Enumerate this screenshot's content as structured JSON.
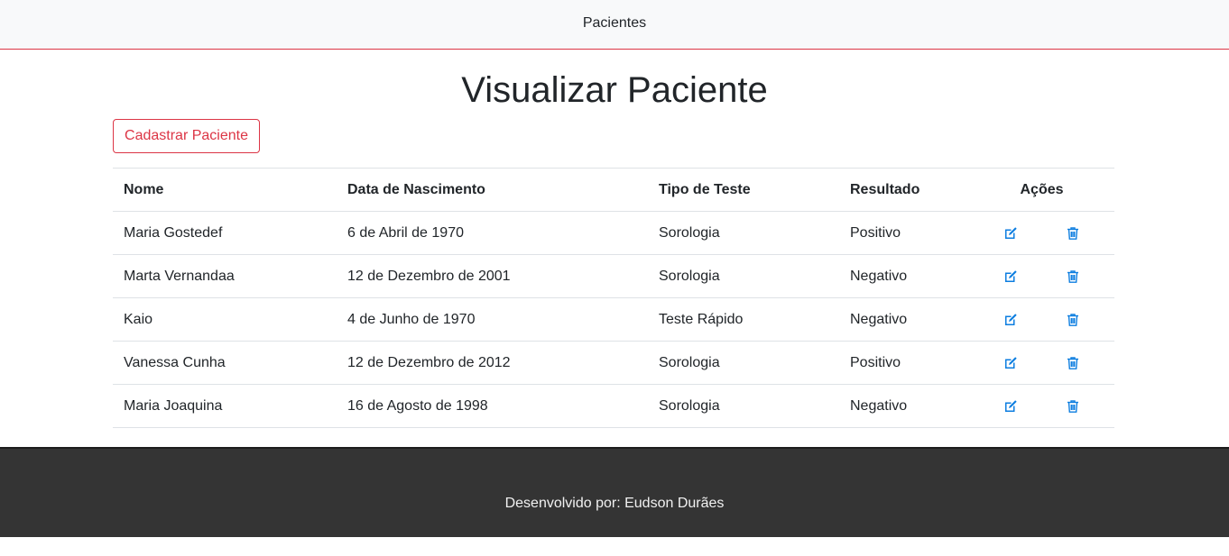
{
  "navbar": {
    "brand": "Pacientes"
  },
  "page": {
    "title": "Visualizar Paciente",
    "add_button": "Cadastrar Paciente"
  },
  "table": {
    "headers": {
      "nome": "Nome",
      "data": "Data de Nascimento",
      "tipo": "Tipo de Teste",
      "resultado": "Resultado",
      "acoes": "Ações"
    },
    "rows": [
      {
        "nome": "Maria Gostedef",
        "data": "6 de Abril de 1970",
        "tipo": "Sorologia",
        "resultado": "Positivo"
      },
      {
        "nome": "Marta Vernandaa",
        "data": "12 de Dezembro de 2001",
        "tipo": "Sorologia",
        "resultado": "Negativo"
      },
      {
        "nome": "Kaio",
        "data": "4 de Junho de 1970",
        "tipo": "Teste Rápido",
        "resultado": "Negativo"
      },
      {
        "nome": "Vanessa Cunha",
        "data": "12 de Dezembro de 2012",
        "tipo": "Sorologia",
        "resultado": "Positivo"
      },
      {
        "nome": "Maria Joaquina",
        "data": "16 de Agosto de 1998",
        "tipo": "Sorologia",
        "resultado": "Negativo"
      }
    ],
    "action_icons": {
      "edit": "edit-icon",
      "delete": "trash-icon"
    }
  },
  "colors": {
    "accent": "#dc3545",
    "icon": "#0d7ee0",
    "footer_bg": "#343434"
  },
  "footer": {
    "text": "Desenvolvido por: Eudson Durães"
  }
}
